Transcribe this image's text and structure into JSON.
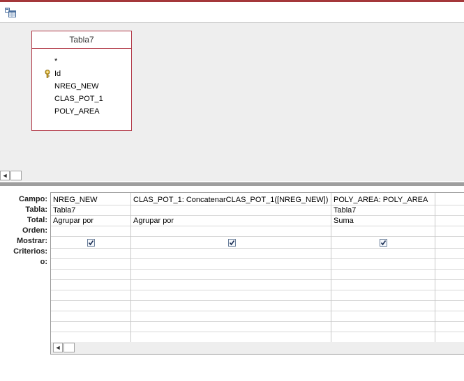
{
  "table": {
    "title": "Tabla7",
    "fields": [
      "*",
      "Id",
      "NREG_NEW",
      "CLAS_POT_1",
      "POLY_AREA"
    ],
    "primary_key": "Id"
  },
  "row_labels": [
    "Campo:",
    "Tabla:",
    "Total:",
    "Orden:",
    "Mostrar:",
    "Criterios:",
    "o:"
  ],
  "columns": [
    {
      "campo": "NREG_NEW",
      "tabla": "Tabla7",
      "total": "Agrupar por",
      "orden": "",
      "mostrar": true,
      "criterios": "",
      "o": ""
    },
    {
      "campo": "CLAS_POT_1: ConcatenarCLAS_POT_1([NREG_NEW])",
      "tabla": "",
      "total": "Agrupar por",
      "orden": "",
      "mostrar": true,
      "criterios": "",
      "o": ""
    },
    {
      "campo": "POLY_AREA: POLY_AREA",
      "tabla": "Tabla7",
      "total": "Suma",
      "orden": "",
      "mostrar": true,
      "criterios": "",
      "o": ""
    }
  ],
  "scroll_left_glyph": "◄",
  "colors": {
    "accent": "#a4373a",
    "table_border": "#b23a48",
    "panel_bg": "#eeeeee"
  }
}
